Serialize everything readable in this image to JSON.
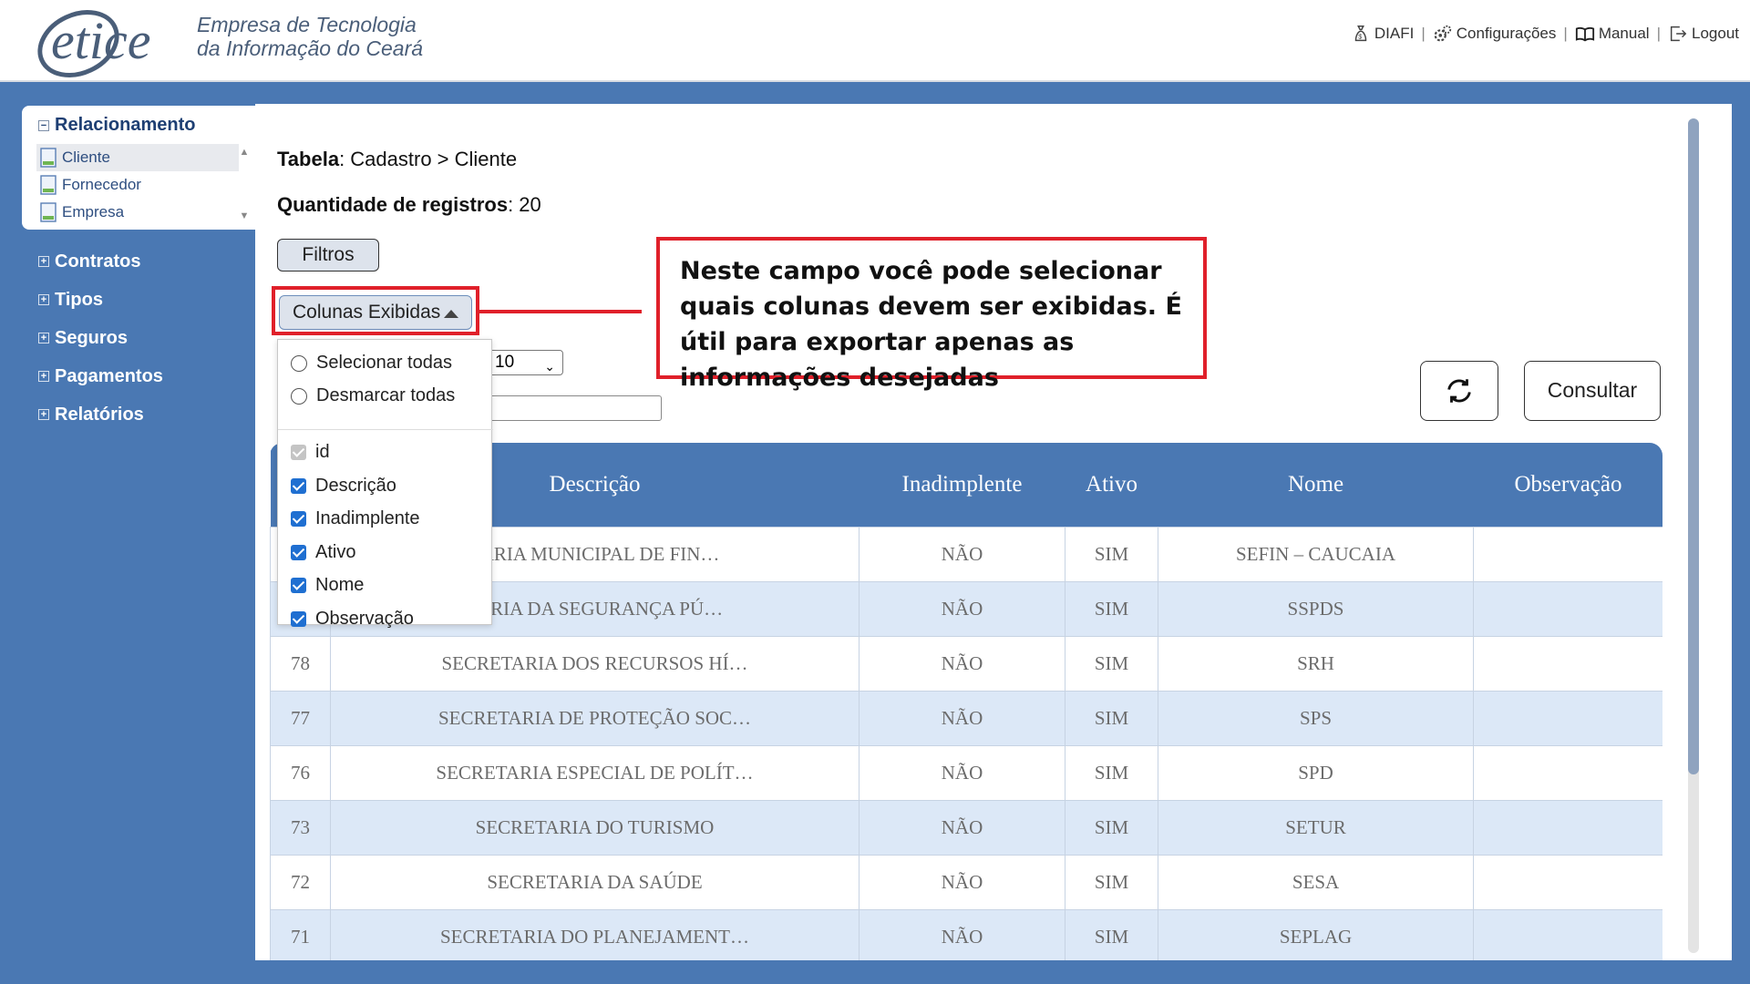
{
  "header": {
    "logo_word": "etice",
    "company_line1": "Empresa de Tecnologia",
    "company_line2": "da Informação do Ceará",
    "nav": [
      {
        "label": "DIAFI",
        "icon": "money-bag-icon"
      },
      {
        "label": "Configurações",
        "icon": "gears-icon"
      },
      {
        "label": "Manual",
        "icon": "book-icon"
      },
      {
        "label": "Logout",
        "icon": "logout-icon"
      }
    ],
    "separator": "|"
  },
  "sidebar": {
    "group_title": "Relacionamento",
    "group_items": [
      {
        "label": "Cliente",
        "active": true
      },
      {
        "label": "Fornecedor",
        "active": false
      },
      {
        "label": "Empresa",
        "active": false
      }
    ],
    "menu": [
      {
        "label": "Contratos"
      },
      {
        "label": "Tipos"
      },
      {
        "label": "Seguros"
      },
      {
        "label": "Pagamentos"
      },
      {
        "label": "Relatórios"
      }
    ]
  },
  "main": {
    "table_label": "Tabela",
    "table_path": ": Cadastro > Cliente",
    "count_label": "Quantidade de registros",
    "count_value": ": 20",
    "filters_button": "Filtros",
    "columns_button": "Colunas Exibidas",
    "page_size": "10",
    "consult_button": "Consultar",
    "callout_text": "Neste campo você pode selecionar quais colunas devem ser exibidas. É útil para exportar apenas as informações desejadas"
  },
  "dropdown": {
    "select_all": "Selecionar todas",
    "deselect_all": "Desmarcar todas",
    "columns": [
      {
        "label": "id",
        "checked": true,
        "disabled": true
      },
      {
        "label": "Descrição",
        "checked": true,
        "disabled": false
      },
      {
        "label": "Inadimplente",
        "checked": true,
        "disabled": false
      },
      {
        "label": "Ativo",
        "checked": true,
        "disabled": false
      },
      {
        "label": "Nome",
        "checked": true,
        "disabled": false
      },
      {
        "label": "Observação",
        "checked": true,
        "disabled": false
      }
    ]
  },
  "table": {
    "headers": [
      "",
      "Descrição",
      "Inadimplente",
      "Ativo",
      "Nome",
      "Observação"
    ],
    "rows": [
      {
        "id": "",
        "descricao": "TARIA MUNICIPAL DE FIN…",
        "inadimplente": "NÃO",
        "ativo": "SIM",
        "nome": "SEFIN – CAUCAIA",
        "obs": ""
      },
      {
        "id": "",
        "descricao": "TARIA DA SEGURANÇA PÚ…",
        "inadimplente": "NÃO",
        "ativo": "SIM",
        "nome": "SSPDS",
        "obs": ""
      },
      {
        "id": "78",
        "descricao": "SECRETARIA DOS RECURSOS HÍ…",
        "inadimplente": "NÃO",
        "ativo": "SIM",
        "nome": "SRH",
        "obs": ""
      },
      {
        "id": "77",
        "descricao": "SECRETARIA DE PROTEÇÃO SOC…",
        "inadimplente": "NÃO",
        "ativo": "SIM",
        "nome": "SPS",
        "obs": ""
      },
      {
        "id": "76",
        "descricao": "SECRETARIA ESPECIAL DE POLÍT…",
        "inadimplente": "NÃO",
        "ativo": "SIM",
        "nome": "SPD",
        "obs": ""
      },
      {
        "id": "73",
        "descricao": "SECRETARIA DO TURISMO",
        "inadimplente": "NÃO",
        "ativo": "SIM",
        "nome": "SETUR",
        "obs": ""
      },
      {
        "id": "72",
        "descricao": "SECRETARIA DA SAÚDE",
        "inadimplente": "NÃO",
        "ativo": "SIM",
        "nome": "SESA",
        "obs": ""
      },
      {
        "id": "71",
        "descricao": "SECRETARIA DO PLANEJAMENT…",
        "inadimplente": "NÃO",
        "ativo": "SIM",
        "nome": "SEPLAG",
        "obs": ""
      }
    ]
  },
  "colors": {
    "frame_blue": "#4a78b3",
    "highlight_red": "#e0202a",
    "row_alt": "#dce8f7",
    "checkbox_blue": "#1f6fd1"
  }
}
